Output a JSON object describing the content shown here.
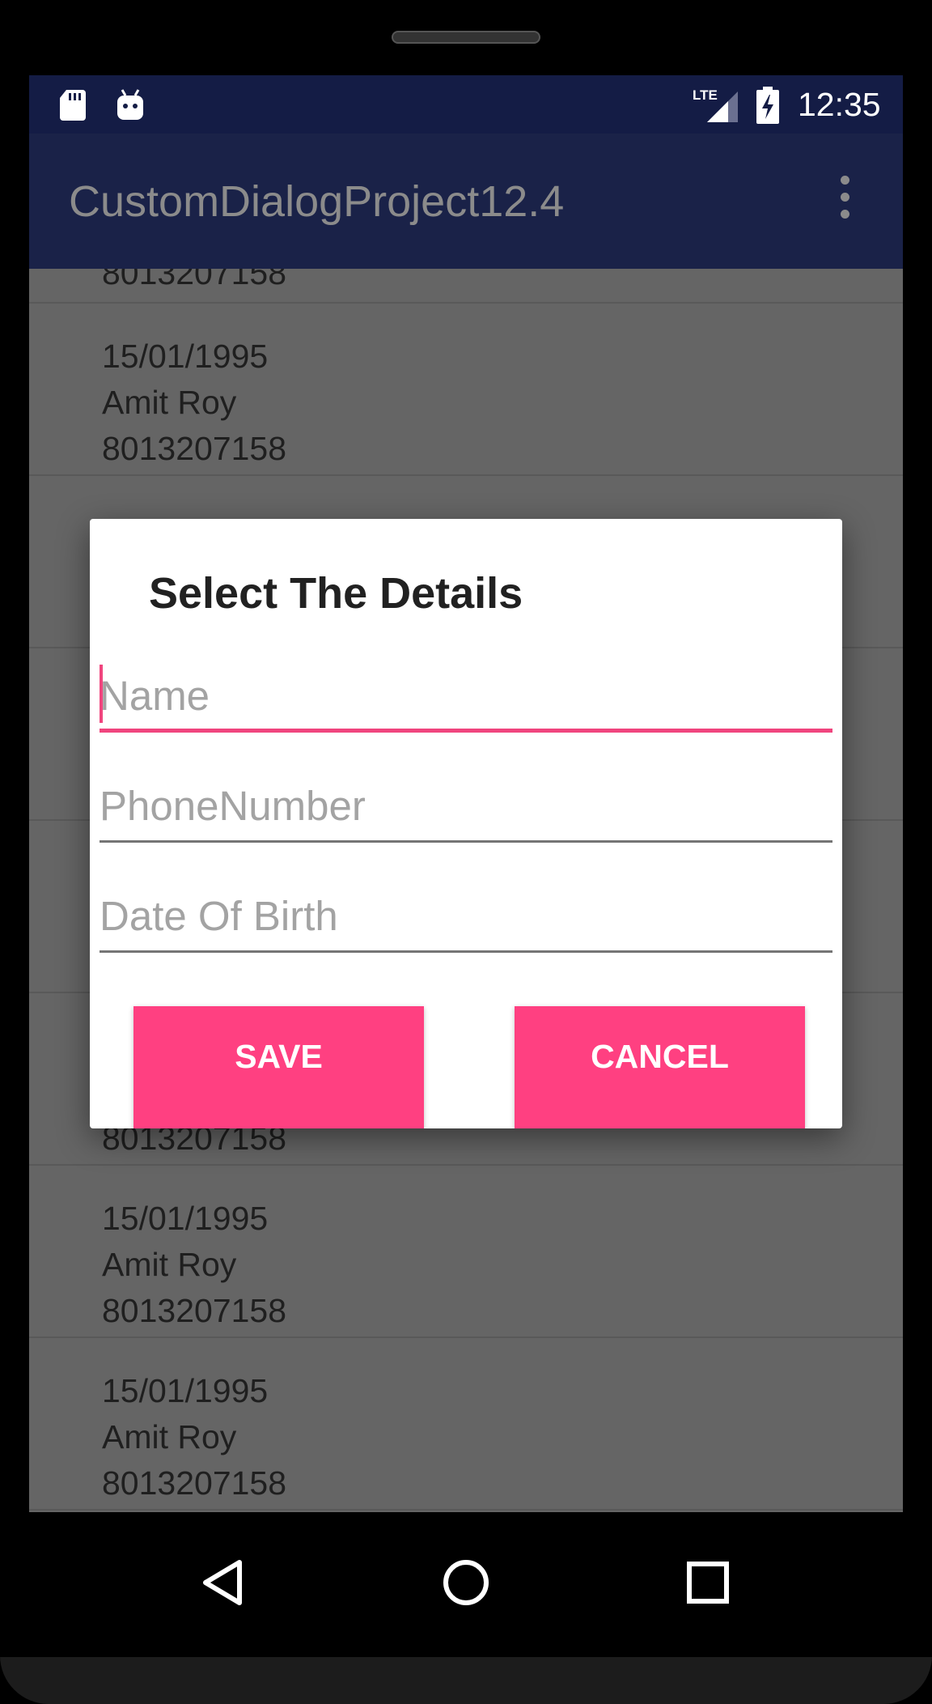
{
  "status_bar": {
    "time": "12:35",
    "network_label": "LTE",
    "icons": [
      "sd-card-icon",
      "android-debug-icon",
      "lte-signal-icon",
      "battery-charging-icon"
    ]
  },
  "app_bar": {
    "title": "CustomDialogProject12.4",
    "menu_icon": "overflow-menu-icon"
  },
  "list": {
    "items": [
      {
        "lines": [
          "8013207158"
        ]
      },
      {
        "lines": [
          "15/01/1995",
          "Amit Roy",
          "8013207158"
        ]
      },
      {
        "lines": [
          "",
          "",
          ""
        ]
      },
      {
        "lines": [
          "",
          "",
          ""
        ]
      },
      {
        "lines": [
          "",
          "",
          ""
        ]
      },
      {
        "lines": [
          "8013207158"
        ]
      },
      {
        "lines": [
          "15/01/1995",
          "Amit Roy",
          "8013207158"
        ]
      },
      {
        "lines": [
          "15/01/1995",
          "Amit Roy",
          "8013207158"
        ]
      }
    ]
  },
  "dialog": {
    "title": "Select The Details",
    "fields": {
      "name": {
        "value": "",
        "placeholder": "Name"
      },
      "phone": {
        "value": "",
        "placeholder": "PhoneNumber"
      },
      "dob": {
        "value": "",
        "placeholder": "Date Of Birth"
      }
    },
    "save_label": "SAVE",
    "cancel_label": "CANCEL"
  },
  "nav": {
    "icons": [
      "back-icon",
      "home-icon",
      "recent-apps-icon"
    ]
  },
  "colors": {
    "status_bar": "#141c45",
    "app_bar": "#1a2248",
    "accent": "#ff4081",
    "focus_underline": "#f0457e",
    "scrim_list": "#656565"
  }
}
